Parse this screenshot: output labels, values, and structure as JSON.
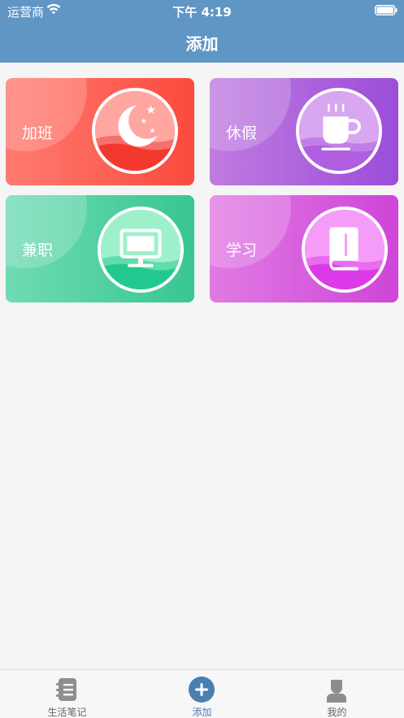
{
  "status_bar": {
    "carrier": "运营商",
    "time": "下午 4:19",
    "wifi_icon": "wifi-icon",
    "battery_icon": "battery-icon"
  },
  "nav": {
    "title": "添加"
  },
  "colors": {
    "header": "#5f96c4",
    "tab_active": "#4a7fb0",
    "tab_inactive": "#8e8e8e"
  },
  "cards": [
    {
      "label": "加班",
      "icon": "moon-stars-icon",
      "color_start": "#ff7b70",
      "color_end": "#fb4a3d"
    },
    {
      "label": "休假",
      "icon": "coffee-cup-icon",
      "color_start": "#c07be0",
      "color_end": "#9b4dd8"
    },
    {
      "label": "兼职",
      "icon": "monitor-icon",
      "color_start": "#6fdbb3",
      "color_end": "#38c693"
    },
    {
      "label": "学习",
      "icon": "book-icon",
      "color_start": "#e07ae3",
      "color_end": "#cf45d8"
    }
  ],
  "tabbar": {
    "items": [
      {
        "label": "生活笔记",
        "icon": "notebook-icon",
        "active": false
      },
      {
        "label": "添加",
        "icon": "plus-circle-icon",
        "active": true
      },
      {
        "label": "我的",
        "icon": "user-icon",
        "active": false
      }
    ]
  }
}
